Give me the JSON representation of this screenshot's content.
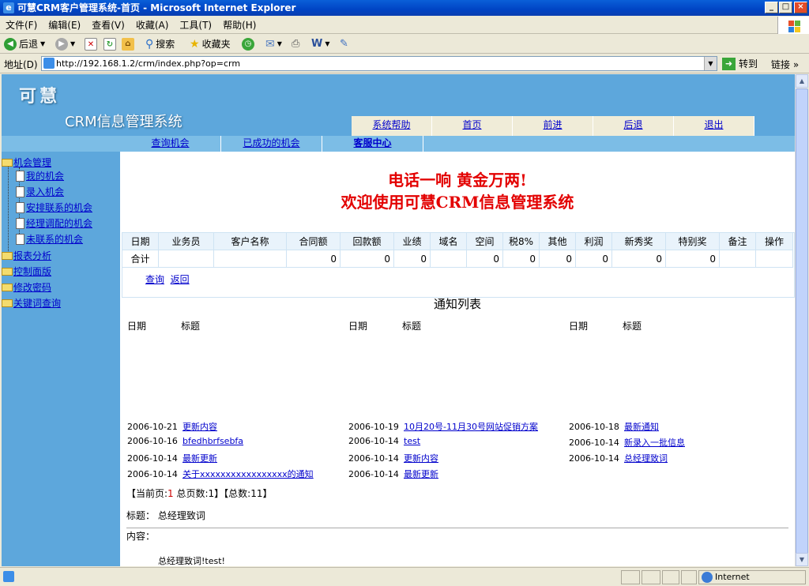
{
  "window": {
    "title": "可慧CRM客户管理系统-首页 - Microsoft Internet Explorer",
    "min": "_",
    "max": "□",
    "close": "×"
  },
  "menu": [
    "文件(F)",
    "编辑(E)",
    "查看(V)",
    "收藏(A)",
    "工具(T)",
    "帮助(H)"
  ],
  "toolbar": {
    "back": "后退",
    "search": "搜索",
    "favorites": "收藏夹"
  },
  "address": {
    "label": "地址(D)",
    "url": "http://192.168.1.2/crm/index.php?op=crm",
    "go": "转到",
    "links": "链接"
  },
  "status": {
    "zone": "Internet"
  },
  "header": {
    "logo": "可慧",
    "system_title": "CRM信息管理系统"
  },
  "topnav": [
    "系统帮助",
    "首页",
    "前进",
    "后退",
    "退出"
  ],
  "subnav": [
    "查询机会",
    "已成功的机会",
    "客服中心"
  ],
  "sidebar": {
    "root1": "机会管理",
    "children": [
      "我的机会",
      "录入机会",
      "安排联系的机会",
      "经理调配的机会",
      "未联系的机会"
    ],
    "others": [
      "报表分析",
      "控制面版",
      "修改密码",
      "关键词查询"
    ]
  },
  "slogan": {
    "line1": "电话一响 黄金万两!",
    "line2": "欢迎使用可慧CRM信息管理系统"
  },
  "table": {
    "headers": [
      "日期",
      "业务员",
      "客户名称",
      "合同额",
      "回款额",
      "业绩",
      "域名",
      "空间",
      "税8%",
      "其他",
      "利润",
      "新秀奖",
      "特别奖",
      "备注",
      "操作"
    ],
    "total": [
      "合计",
      "",
      "",
      "0",
      "0",
      "0",
      "",
      "0",
      "0",
      "0",
      "0",
      "0",
      "0",
      "",
      ""
    ]
  },
  "query_links": {
    "query": "查询",
    "back": "返回"
  },
  "notices": {
    "title": "通知列表",
    "col_date": "日期",
    "col_title": "标题",
    "columns": [
      [
        {
          "date": "2006-10-21",
          "title": "更新内容"
        },
        {
          "date": "2006-10-16",
          "title": "bfedhbrfsebfa"
        },
        {
          "date": "2006-10-14",
          "title": "最新更新"
        },
        {
          "date": "2006-10-14",
          "title": "关于xxxxxxxxxxxxxxxxx的通知"
        }
      ],
      [
        {
          "date": "2006-10-19",
          "title": "10月20号-11月30号网站促销方案"
        },
        {
          "date": "2006-10-14",
          "title": "test"
        },
        {
          "date": "2006-10-14",
          "title": "更新内容"
        },
        {
          "date": "2006-10-14",
          "title": "最新更新"
        }
      ],
      [
        {
          "date": "2006-10-18",
          "title": "最新通知"
        },
        {
          "date": "2006-10-14",
          "title": "新录入一批信息"
        },
        {
          "date": "2006-10-14",
          "title": "总经理致词"
        }
      ]
    ]
  },
  "pager": {
    "p1": "【当前页:",
    "current": "1",
    "p2": " 总页数:1】【总数:11】"
  },
  "detail": {
    "title_label": "标题：",
    "title": "总经理致词",
    "content_label": "内容：",
    "content": "总经理致词!test!"
  }
}
